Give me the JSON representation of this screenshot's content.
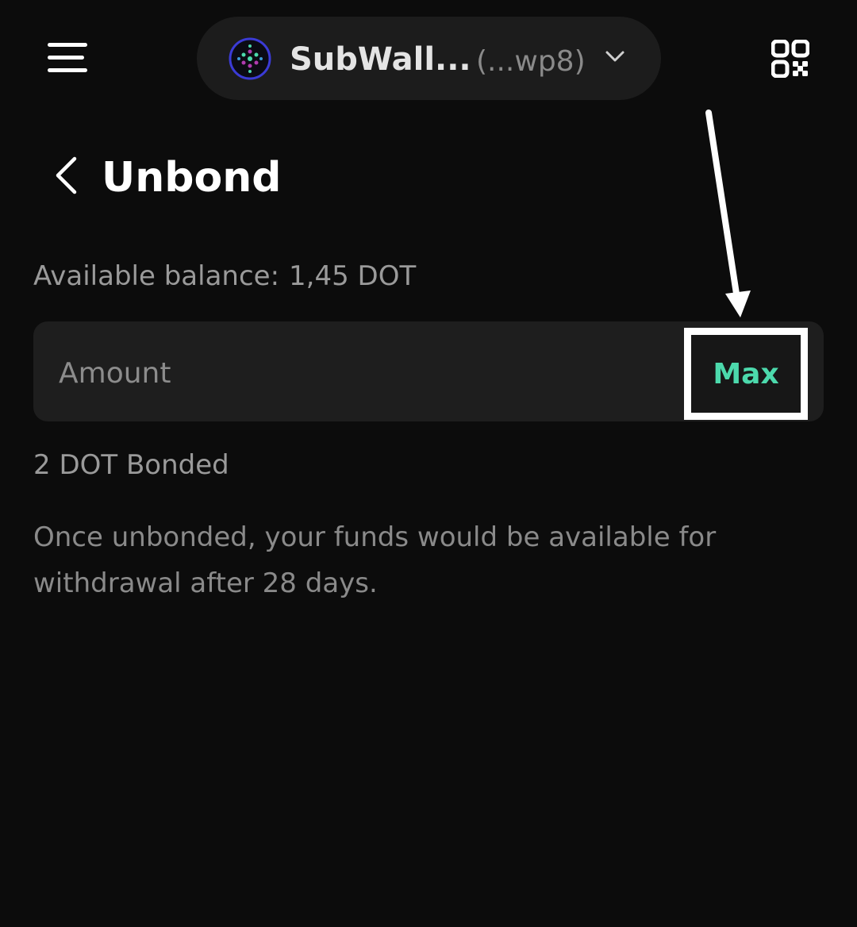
{
  "topbar": {
    "account_name": "SubWall...",
    "account_address": "(...wp8)"
  },
  "header": {
    "title": "Unbond"
  },
  "balance": {
    "label": "Available balance:",
    "value": "1,45 DOT"
  },
  "amount_field": {
    "placeholder": "Amount",
    "value": ""
  },
  "max_button": {
    "label": "Max"
  },
  "bonded": {
    "text": "2 DOT Bonded"
  },
  "info": {
    "text": "Once unbonded, your funds would be available for withdrawal after 28 days."
  },
  "colors": {
    "background": "#0c0c0c",
    "surface": "#1e1e1e",
    "accent": "#4cd9ac",
    "muted_text": "#9a9a9a",
    "annotation": "#ffffff"
  },
  "icons": {
    "menu": "hamburger-icon",
    "avatar": "subwallet-logo-icon",
    "dropdown": "chevron-down-icon",
    "qr": "qr-code-icon",
    "back": "chevron-left-icon",
    "annotation": "arrow-down-icon"
  }
}
